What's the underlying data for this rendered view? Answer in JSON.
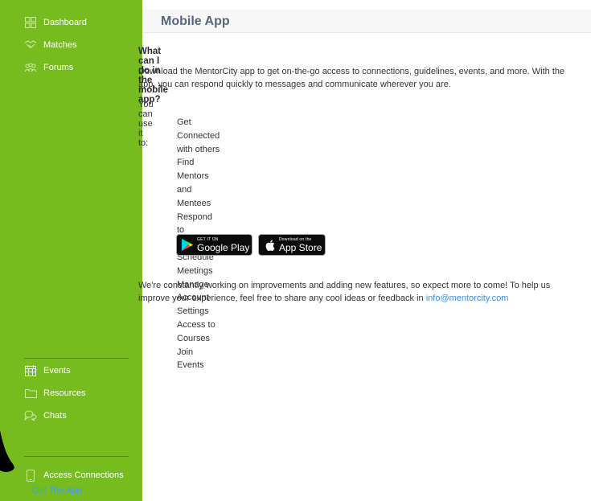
{
  "sidebar": {
    "top_items": [
      {
        "label": "Dashboard",
        "icon": "grid-icon"
      },
      {
        "label": "Matches",
        "icon": "handshake-icon"
      },
      {
        "label": "Forums",
        "icon": "group-icon"
      }
    ],
    "bottom_items": [
      {
        "label": "Events",
        "icon": "calendar-icon"
      },
      {
        "label": "Resources",
        "icon": "folder-icon"
      },
      {
        "label": "Chats",
        "icon": "chat-icon"
      }
    ],
    "footer_item": {
      "label": "Access Connections",
      "icon": "phone-icon"
    },
    "get_app_link": "Get The App",
    "colors": {
      "background": "#77bc1f",
      "text": "#ffffff",
      "link": "#3aa3e9"
    }
  },
  "main": {
    "title": "Mobile App",
    "section_heading": "What can I do in the mobile app?",
    "intro": "Download the MentorCity app to get on-the-go access to connections, guidelines, events, and more. With the app, you can respond quickly to messages and communicate wherever you are.",
    "use_label": "You can use it to:",
    "features": [
      "Get Connected with others",
      "Find Mentors and Mentees",
      "Respond to Messages",
      "Schedule Meetings",
      "Manage Account Settings",
      "Access to Courses",
      "Join Events"
    ],
    "google_play": {
      "small": "GET IT ON",
      "big": "Google Play"
    },
    "app_store": {
      "small": "Download on the",
      "big": "App Store"
    },
    "outro_text": "We're constantly working on improvements and adding new features, so expect more to come! To help us improve your experience, feel free to share any cool ideas or feedback in ",
    "email": "info@mentorcity.com",
    "colors": {
      "title": "#5a6578",
      "link": "#3a8ee6"
    }
  }
}
